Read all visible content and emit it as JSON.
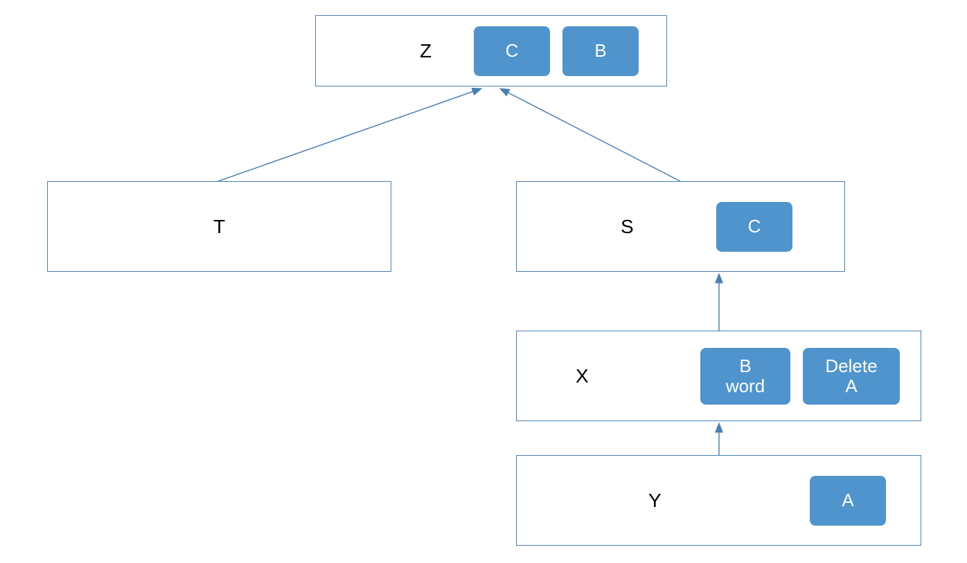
{
  "nodes": {
    "z": {
      "label": "Z",
      "badges": [
        "C",
        "B"
      ]
    },
    "t": {
      "label": "T",
      "badges": []
    },
    "s": {
      "label": "S",
      "badges": [
        "C"
      ]
    },
    "x": {
      "label": "X",
      "badges": [
        "B word",
        "Delete A"
      ]
    },
    "y": {
      "label": "Y",
      "badges": [
        "A"
      ]
    }
  },
  "colors": {
    "border": "#4a7fb5",
    "badge_bg": "#4f94cd",
    "badge_text": "#ffffff",
    "arrow": "#4a7fb5"
  }
}
